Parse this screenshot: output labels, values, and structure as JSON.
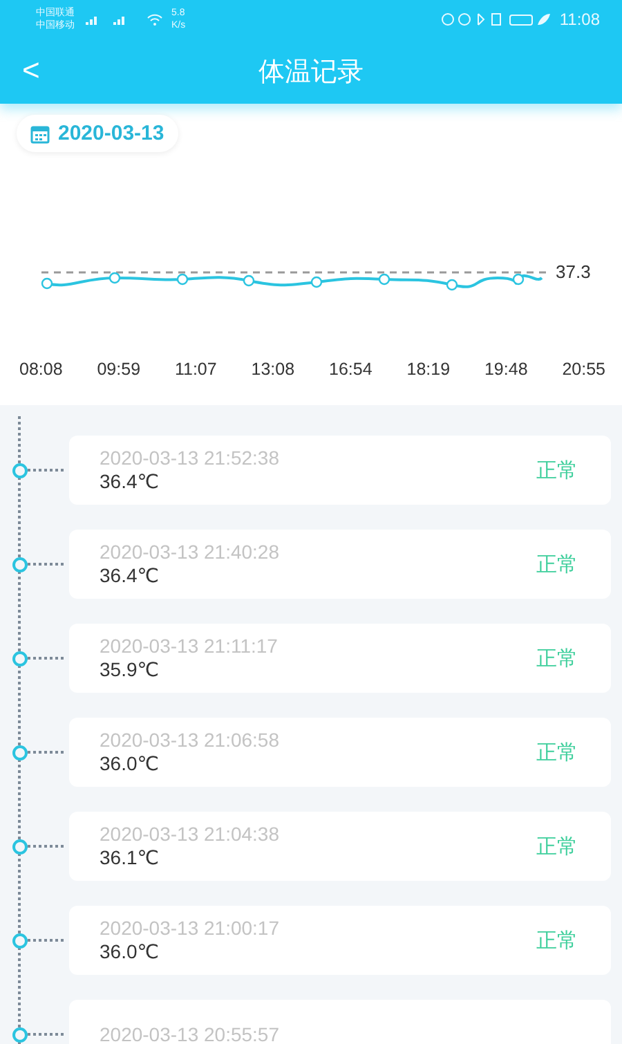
{
  "status_bar": {
    "carriers": [
      "中国联通",
      "中国移动"
    ],
    "speed": "5.8",
    "speed_unit": "K/s",
    "time": "11:08"
  },
  "header": {
    "back": "<",
    "title": "体温记录"
  },
  "date_chip": {
    "date": "2020-03-13"
  },
  "chart": {
    "threshold_label": "37.3",
    "x_labels": [
      "08:08",
      "09:59",
      "11:07",
      "13:08",
      "16:54",
      "18:19",
      "19:48",
      "20:55"
    ]
  },
  "records": [
    {
      "time": "2020-03-13 21:52:38",
      "temperature": "36.4℃",
      "status": "正常"
    },
    {
      "time": "2020-03-13 21:40:28",
      "temperature": "36.4℃",
      "status": "正常"
    },
    {
      "time": "2020-03-13 21:11:17",
      "temperature": "35.9℃",
      "status": "正常"
    },
    {
      "time": "2020-03-13 21:06:58",
      "temperature": "36.0℃",
      "status": "正常"
    },
    {
      "time": "2020-03-13 21:04:38",
      "temperature": "36.1℃",
      "status": "正常"
    },
    {
      "time": "2020-03-13 21:00:17",
      "temperature": "36.0℃",
      "status": "正常"
    },
    {
      "time": "2020-03-13 20:55:57"
    }
  ]
}
